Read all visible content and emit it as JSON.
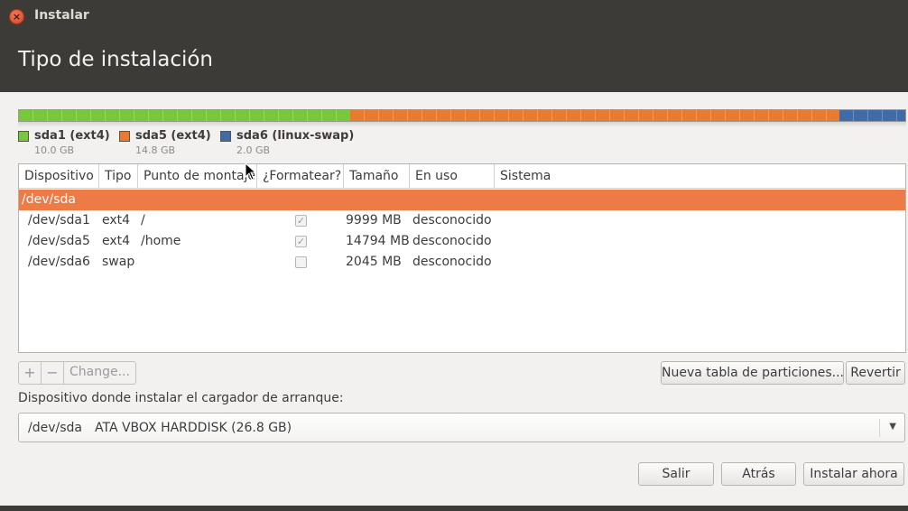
{
  "window": {
    "title": "Instalar"
  },
  "header": {
    "title": "Tipo de instalación"
  },
  "partitions_bar": {
    "segments": [
      {
        "name": "sda1 (ext4)",
        "size": "10.0 GB",
        "color": "#78c83c",
        "fraction": 0.373
      },
      {
        "name": "sda5 (ext4)",
        "size": "14.8 GB",
        "color": "#e97b2f",
        "fraction": 0.552
      },
      {
        "name": "sda6 (linux-swap)",
        "size": "2.0 GB",
        "color": "#3f6ca6",
        "fraction": 0.075
      }
    ]
  },
  "table": {
    "columns": [
      "Dispositivo",
      "Tipo",
      "Punto de montaje",
      "¿Formatear?",
      "Tamaño",
      "En uso",
      "Sistema"
    ],
    "device": "/dev/sda",
    "rows": [
      {
        "device": "/dev/sda1",
        "type": "ext4",
        "mount": "/",
        "format": true,
        "size": "9999 MB",
        "used": "desconocido",
        "system": ""
      },
      {
        "device": "/dev/sda5",
        "type": "ext4",
        "mount": "/home",
        "format": true,
        "size": "14794 MB",
        "used": "desconocido",
        "system": ""
      },
      {
        "device": "/dev/sda6",
        "type": "swap",
        "mount": "",
        "format": false,
        "size": "2045 MB",
        "used": "desconocido",
        "system": ""
      }
    ]
  },
  "toolbar": {
    "add_label": "+",
    "remove_label": "−",
    "change_label": "Change...",
    "new_table_label": "Nueva tabla de particiones...",
    "revert_label": "Revertir"
  },
  "bootloader": {
    "label": "Dispositivo donde instalar el cargador de arranque:",
    "selected_device": "/dev/sda",
    "selected_description": "ATA VBOX HARDDISK (26.8 GB)"
  },
  "footer": {
    "quit_label": "Salir",
    "back_label": "Atrás",
    "install_label": "Instalar ahora"
  }
}
